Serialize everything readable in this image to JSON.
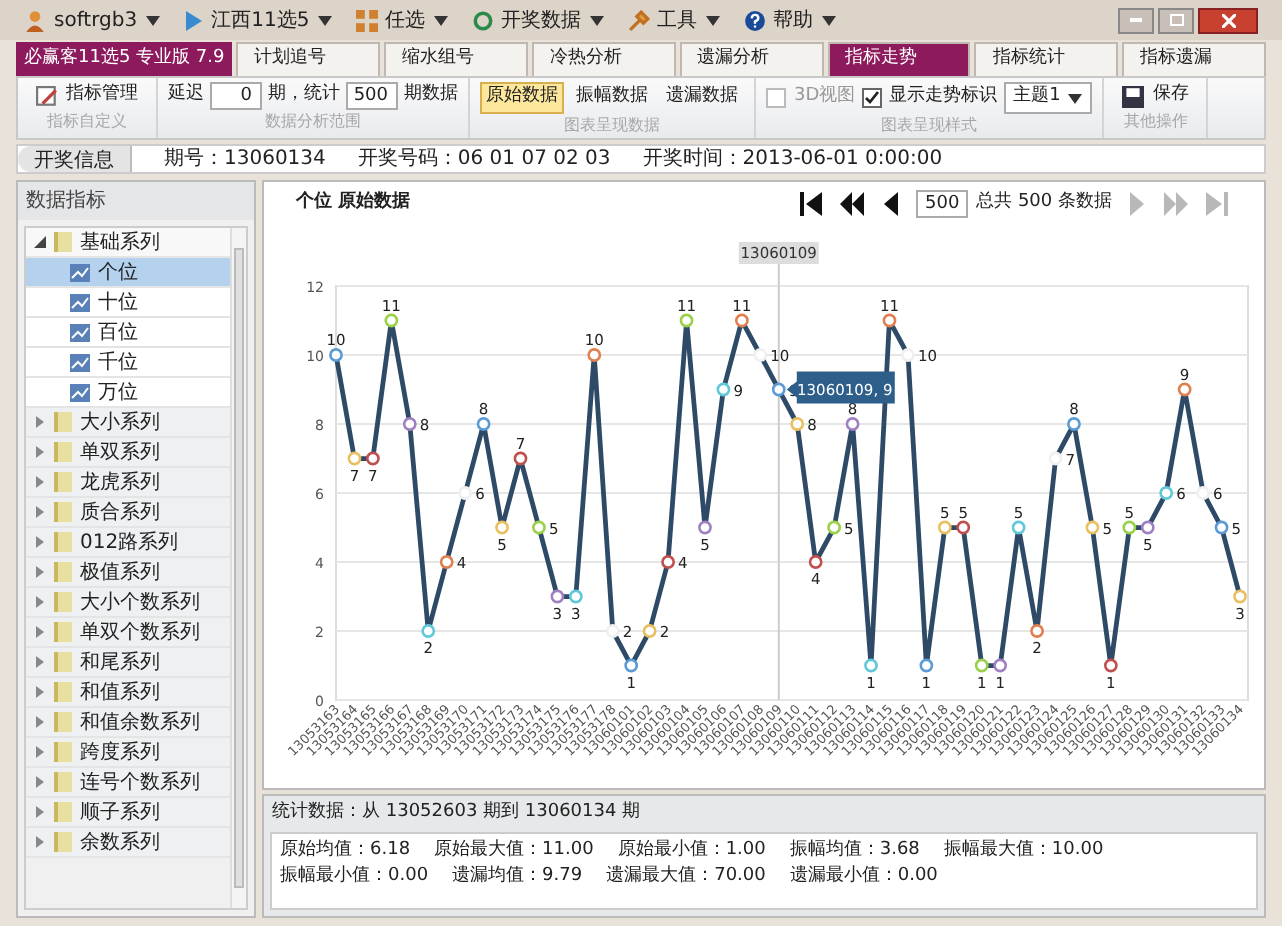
{
  "menu_bar": {
    "items": [
      {
        "label": "softrgb3",
        "kind": "user"
      },
      {
        "label": "江西11选5",
        "kind": "play"
      },
      {
        "label": "任选",
        "kind": "grid"
      },
      {
        "label": "开奖数据",
        "kind": "refresh"
      },
      {
        "label": "工具",
        "kind": "tools"
      },
      {
        "label": "帮助",
        "kind": "help"
      }
    ]
  },
  "brand": "必赢客11选5 专业版 7.9",
  "tabs": [
    {
      "label": "计划追号",
      "selected": false
    },
    {
      "label": "缩水组号",
      "selected": false
    },
    {
      "label": "冷热分析",
      "selected": false
    },
    {
      "label": "遗漏分析",
      "selected": false
    },
    {
      "label": "指标走势",
      "selected": true
    },
    {
      "label": "指标统计",
      "selected": false
    },
    {
      "label": "指标遗漏",
      "selected": false
    }
  ],
  "ribbon": {
    "groups": [
      {
        "caption": "指标自定义",
        "items": [
          {
            "kind": "button",
            "label": "指标管理"
          }
        ]
      },
      {
        "caption": "数据分析范围",
        "items": [
          {
            "kind": "text",
            "label": "延迟"
          },
          {
            "kind": "input",
            "value": "0"
          },
          {
            "kind": "text",
            "label": "期，统计"
          },
          {
            "kind": "input",
            "value": "500"
          },
          {
            "kind": "text",
            "label": "期数据"
          }
        ]
      },
      {
        "caption": "图表呈现数据",
        "items": [
          {
            "kind": "toggle",
            "label": "原始数据",
            "selected": true
          },
          {
            "kind": "toggle",
            "label": "振幅数据",
            "selected": false
          },
          {
            "kind": "toggle",
            "label": "遗漏数据",
            "selected": false
          }
        ]
      },
      {
        "caption": "图表呈现样式",
        "items": [
          {
            "kind": "checkbox",
            "label": "3D视图",
            "checked": false,
            "disabled": true
          },
          {
            "kind": "checkbox",
            "label": "显示走势标识",
            "checked": true,
            "disabled": false
          },
          {
            "kind": "dropdown",
            "label": "主题1"
          }
        ]
      },
      {
        "caption": "其他操作",
        "items": [
          {
            "kind": "save",
            "label": "保存"
          }
        ]
      }
    ]
  },
  "info_bar": {
    "button": "开奖信息",
    "fields": [
      "期号：13060134",
      "开奖号码：06 01 07 02 03",
      "开奖时间：2013-06-01 0:00:00"
    ]
  },
  "sidebar": {
    "title": "数据指标",
    "tree": [
      {
        "label": "基础系列",
        "expanded": true,
        "selected": false,
        "children": [
          {
            "label": "个位",
            "selected": true
          },
          {
            "label": "十位",
            "selected": false
          },
          {
            "label": "百位",
            "selected": false
          },
          {
            "label": "千位",
            "selected": false
          },
          {
            "label": "万位",
            "selected": false
          }
        ]
      },
      {
        "label": "大小系列",
        "expanded": false,
        "selected": false
      },
      {
        "label": "单双系列",
        "expanded": false,
        "selected": false
      },
      {
        "label": "龙虎系列",
        "expanded": false,
        "selected": false
      },
      {
        "label": "质合系列",
        "expanded": false,
        "selected": false
      },
      {
        "label": "012路系列",
        "expanded": false,
        "selected": false
      },
      {
        "label": "极值系列",
        "expanded": false,
        "selected": false
      },
      {
        "label": "大小个数系列",
        "expanded": false,
        "selected": false
      },
      {
        "label": "单双个数系列",
        "expanded": false,
        "selected": false
      },
      {
        "label": "和尾系列",
        "expanded": false,
        "selected": false
      },
      {
        "label": "和值系列",
        "expanded": false,
        "selected": false
      },
      {
        "label": "和值余数系列",
        "expanded": false,
        "selected": false
      },
      {
        "label": "跨度系列",
        "expanded": false,
        "selected": false
      },
      {
        "label": "连号个数系列",
        "expanded": false,
        "selected": false
      },
      {
        "label": "顺子系列",
        "expanded": false,
        "selected": false
      },
      {
        "label": "余数系列",
        "expanded": false,
        "selected": false
      }
    ]
  },
  "chart_panel": {
    "pager": {
      "buttons": [
        {
          "kind": "first",
          "disabled": false
        },
        {
          "kind": "fast-back",
          "disabled": false
        },
        {
          "kind": "back",
          "disabled": false
        },
        {
          "kind": "forward",
          "disabled": true
        },
        {
          "kind": "fast-forward",
          "disabled": true
        },
        {
          "kind": "last",
          "disabled": true
        }
      ],
      "page_size": "500",
      "total": "总共 500 条数据"
    },
    "tooltip": "13060109, 9",
    "chart_data": {
      "type": "line",
      "title": "个位 原始数据",
      "categories": [
        "13053163",
        "13053164",
        "13053165",
        "13053166",
        "13053167",
        "13053168",
        "13053169",
        "13053170",
        "13053171",
        "13053172",
        "13053173",
        "13053174",
        "13053175",
        "13053176",
        "13053177",
        "13053178",
        "13060101",
        "13060102",
        "13060103",
        "13060104",
        "13060105",
        "13060106",
        "13060107",
        "13060108",
        "13060109",
        "13060110",
        "13060111",
        "13060112",
        "13060113",
        "13060114",
        "13060115",
        "13060116",
        "13060117",
        "13060118",
        "13060119",
        "13060120",
        "13060121",
        "13060122",
        "13060123",
        "13060124",
        "13060125",
        "13060126",
        "13060127",
        "13060128",
        "13060129",
        "13060130",
        "13060131",
        "13060132",
        "13060133",
        "13060134"
      ],
      "series": [
        {
          "color": "#2e4a66",
          "marker": "circle",
          "values": [
            10,
            7,
            7,
            11,
            8,
            2,
            4,
            6,
            8,
            5,
            7,
            5,
            3,
            3,
            10,
            2,
            1,
            2,
            4,
            11,
            5,
            9,
            11,
            10,
            9,
            8,
            4,
            5,
            8,
            1,
            11,
            10,
            1,
            5,
            5,
            1,
            1,
            5,
            2,
            7,
            8,
            5,
            1,
            5,
            5,
            6,
            9,
            6,
            5,
            3
          ]
        }
      ],
      "ylim": [
        0,
        12
      ],
      "yticks": [
        0,
        2,
        4,
        6,
        8,
        10,
        12
      ],
      "grid": true,
      "data_labels": true,
      "ref_lines": [
        {
          "axis": "x",
          "value": "13060109",
          "label": "13060109"
        }
      ]
    }
  },
  "stats": {
    "title": "统计数据：从 13052603 期到 13060134 期",
    "items": [
      "原始均值：6.18",
      "原始最大值：11.00",
      "原始最小值：1.00",
      "振幅均值：3.68",
      "振幅最大值：10.00",
      "振幅最小值：0.00",
      "遗漏均值：9.79",
      "遗漏最大值：70.00",
      "遗漏最小值：0.00"
    ]
  }
}
